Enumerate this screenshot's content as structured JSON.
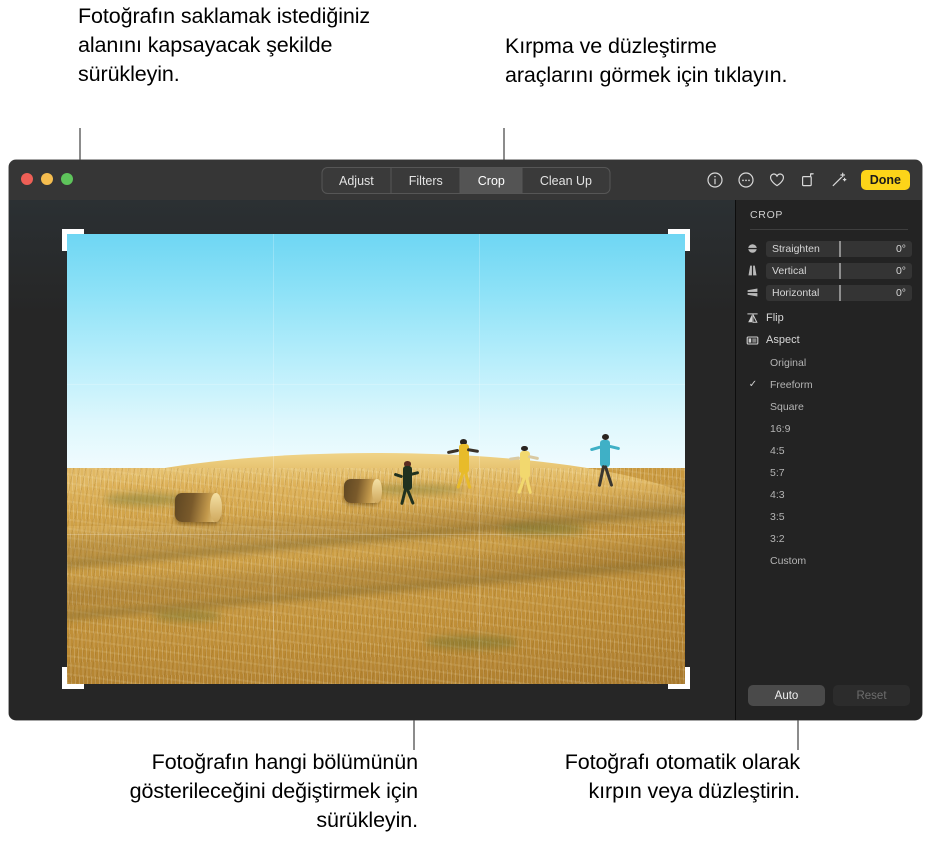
{
  "callouts": {
    "top_left": "Fotoğrafın saklamak istediğiniz alanını kapsayacak şekilde sürükleyin.",
    "top_right": "Kırpma ve düzleştirme araçlarını görmek için tıklayın.",
    "bottom_left": "Fotoğrafın hangi bölümünün gösterileceğini değiştirmek için sürükleyin.",
    "bottom_right": "Fotoğrafı otomatik olarak kırpın veya düzleştirin."
  },
  "window": {
    "traffic_lights": [
      "close-red",
      "minimize-yellow",
      "zoom-green"
    ],
    "segmented": [
      {
        "label": "Adjust",
        "active": false
      },
      {
        "label": "Filters",
        "active": false
      },
      {
        "label": "Crop",
        "active": true
      },
      {
        "label": "Clean Up",
        "active": false
      }
    ],
    "toolbar_icons": [
      "info-icon",
      "more-options-icon",
      "favorite-heart-icon",
      "rotate-icon",
      "enhance-wand-icon"
    ],
    "done_label": "Done"
  },
  "sidebar": {
    "title": "CROP",
    "sliders": [
      {
        "icon": "straighten-icon",
        "label": "Straighten",
        "value": "0°"
      },
      {
        "icon": "vertical-perspective-icon",
        "label": "Vertical",
        "value": "0°"
      },
      {
        "icon": "horizontal-perspective-icon",
        "label": "Horizontal",
        "value": "0°"
      }
    ],
    "menus": [
      {
        "icon": "flip-icon",
        "label": "Flip"
      },
      {
        "icon": "aspect-icon",
        "label": "Aspect"
      }
    ],
    "aspect_options": [
      {
        "label": "Original",
        "selected": false
      },
      {
        "label": "Freeform",
        "selected": true
      },
      {
        "label": "Square",
        "selected": false
      },
      {
        "label": "16:9",
        "selected": false
      },
      {
        "label": "4:5",
        "selected": false
      },
      {
        "label": "5:7",
        "selected": false
      },
      {
        "label": "4:3",
        "selected": false
      },
      {
        "label": "3:5",
        "selected": false
      },
      {
        "label": "3:2",
        "selected": false
      },
      {
        "label": "Custom",
        "selected": false
      }
    ],
    "check_glyph": "✓",
    "buttons": {
      "auto": "Auto",
      "reset": "Reset"
    }
  },
  "photo": {
    "description": "four-children-running-on-golden-stubble-field-at-sunset",
    "colors": {
      "sky_top": "#6ed6f3",
      "sky_bottom": "#ffffff",
      "field_light": "#e9c473",
      "field_dark": "#a8792c",
      "accent_yellow": "#fcd419"
    }
  }
}
